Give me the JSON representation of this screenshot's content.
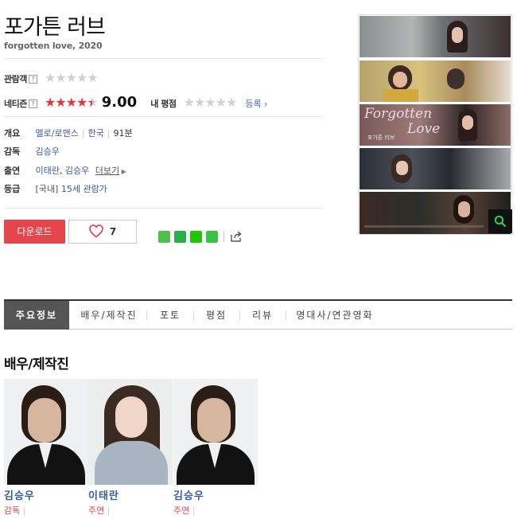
{
  "movie": {
    "title": "포가튼 러브",
    "subtitle": "forgotten love, 2020"
  },
  "ratings": {
    "audience_label": "관람객",
    "netizen_label": "네티즌",
    "netizen_score": "9.00",
    "netizen_stars": 9.0,
    "my_rating_label": "내 평점",
    "register_label": "등록",
    "help_glyph": "?"
  },
  "info": {
    "overview_label": "개요",
    "genre": "멜로/로맨스",
    "country": "한국",
    "runtime": "91분",
    "director_label": "감독",
    "director": "김승우",
    "cast_label": "출연",
    "cast_1": "이태란",
    "cast_2": "김승우",
    "more_label": "더보기",
    "rating_label": "등급",
    "rating_region": "[국내]",
    "rating_value": "15세 관람가"
  },
  "actions": {
    "download_label": "다운로드",
    "like_count": "7"
  },
  "poster_text": {
    "title_en_1": "Forgotten",
    "title_en_2": "Love",
    "title_ko": "포가튼 러브"
  },
  "tabs": [
    "주요정보",
    "배우/제작진",
    "포토",
    "평점",
    "리뷰",
    "명대사/연관영화"
  ],
  "cast_section": {
    "title": "배우/제작진",
    "people": [
      {
        "name": "김승우",
        "role": "감독"
      },
      {
        "name": "이태란",
        "role": "주연"
      },
      {
        "name": "김승우",
        "role": "주연"
      }
    ]
  },
  "colors": {
    "accent_red": "#e5454b",
    "link_blue": "#3a5c9e",
    "star_red": "#e5353d",
    "tab_active": "#555555"
  }
}
